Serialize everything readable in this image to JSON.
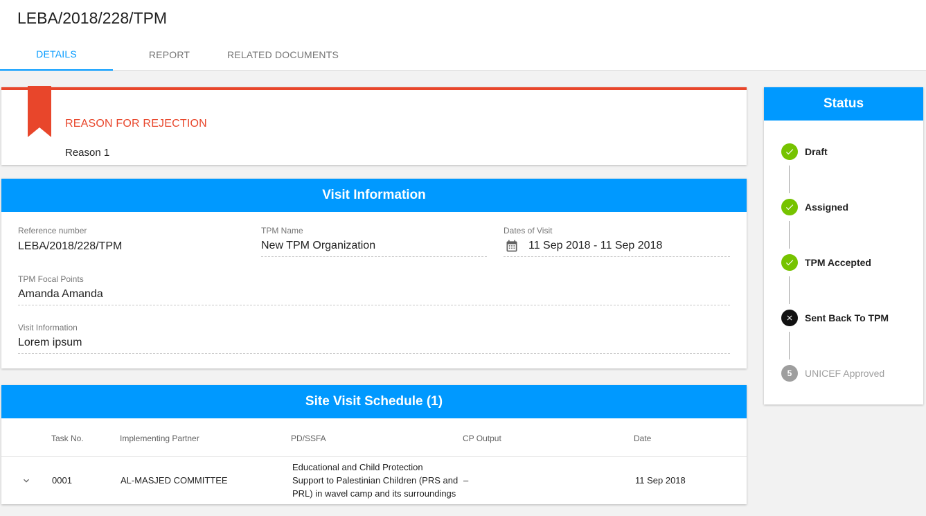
{
  "page": {
    "title": "LEBA/2018/228/TPM"
  },
  "tabs": [
    {
      "label": "DETAILS",
      "active": true
    },
    {
      "label": "REPORT",
      "active": false
    },
    {
      "label": "RELATED DOCUMENTS",
      "active": false
    }
  ],
  "rejection": {
    "title": "REASON FOR REJECTION",
    "text": "Reason 1",
    "accent_color": "#e8462b"
  },
  "visit_info": {
    "title": "Visit Information",
    "reference_number": {
      "label": "Reference number",
      "value": "LEBA/2018/228/TPM"
    },
    "tpm_name": {
      "label": "TPM Name",
      "value": "New TPM Organization"
    },
    "dates": {
      "label": "Dates of Visit",
      "value": "11 Sep 2018 - 11 Sep 2018",
      "icon": "calendar-icon"
    },
    "focal_points": {
      "label": "TPM Focal Points",
      "value": "Amanda Amanda"
    },
    "visit_information": {
      "label": "Visit Information",
      "value": "Lorem ipsum"
    }
  },
  "schedule": {
    "title": "Site Visit Schedule (1)",
    "columns": [
      "Task No.",
      "Implementing Partner",
      "PD/SSFA",
      "CP Output",
      "Date"
    ],
    "rows": [
      {
        "task_no": "0001",
        "partner": "AL-MASJED COMMITTEE",
        "pd_lines": [
          "Educational and Child Protection",
          "Support to Palestinian Children (PRS and",
          "PRL) in wavel camp and its surroundings"
        ],
        "cp_output": "–",
        "date": "11 Sep 2018"
      }
    ]
  },
  "status": {
    "title": "Status",
    "steps": [
      {
        "label": "Draft",
        "state": "done"
      },
      {
        "label": "Assigned",
        "state": "done"
      },
      {
        "label": "TPM Accepted",
        "state": "done"
      },
      {
        "label": "Sent Back To TPM",
        "state": "rejected"
      },
      {
        "label": "UNICEF Approved",
        "state": "pending",
        "number": "5"
      }
    ]
  },
  "colors": {
    "primary": "#0099ff",
    "success": "#76c300",
    "danger": "#e8462b",
    "pending": "#9e9e9e"
  }
}
